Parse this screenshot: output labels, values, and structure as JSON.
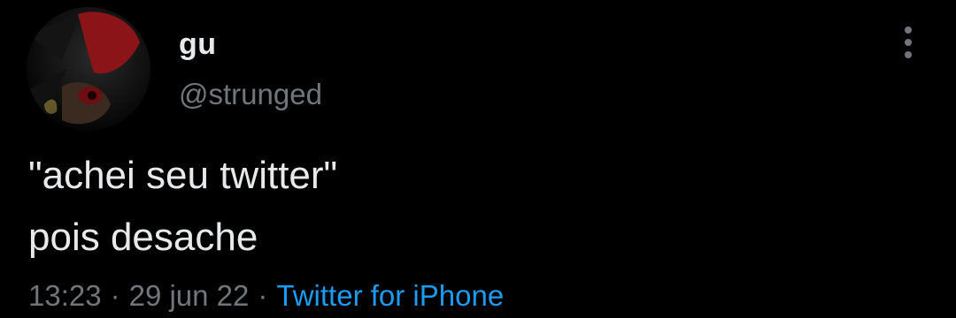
{
  "tweet": {
    "author": {
      "display_name": "gu",
      "handle": "@strunged"
    },
    "text_lines": [
      "\"achei seu twitter\"",
      "pois desache"
    ],
    "time": "13:23",
    "date": "29 jun 22",
    "separator": "·",
    "source": "Twitter for iPhone"
  },
  "icons": {
    "more": "more-vertical-icon"
  },
  "colors": {
    "background": "#000000",
    "text": "#e7e9ea",
    "muted": "#71767b",
    "link": "#1d9bf0"
  }
}
